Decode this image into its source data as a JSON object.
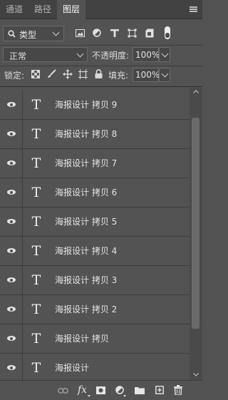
{
  "tabs": [
    {
      "label": "通道",
      "active": false
    },
    {
      "label": "路径",
      "active": false
    },
    {
      "label": "图层",
      "active": true
    }
  ],
  "filter": {
    "selected": "类型",
    "icons": [
      "image-filter-icon",
      "adjustment-filter-icon",
      "type-filter-icon",
      "shape-filter-icon",
      "smart-object-filter-icon",
      "filter-toggle-icon"
    ]
  },
  "blend_mode": {
    "selected": "正常"
  },
  "opacity": {
    "label": "不透明度:",
    "value": "100%"
  },
  "lock": {
    "label": "锁定:",
    "icons": [
      "lock-transparent-pixels-icon",
      "lock-image-pixels-icon",
      "lock-position-icon",
      "lock-artboard-icon",
      "lock-all-icon"
    ]
  },
  "fill": {
    "label": "填充:",
    "value": "100%"
  },
  "layers": [
    {
      "name": "海报设计 拷贝 9",
      "type": "text",
      "visible": true
    },
    {
      "name": "海报设计 拷贝 8",
      "type": "text",
      "visible": true
    },
    {
      "name": "海报设计 拷贝 7",
      "type": "text",
      "visible": true
    },
    {
      "name": "海报设计 拷贝 6",
      "type": "text",
      "visible": true
    },
    {
      "name": "海报设计 拷贝 5",
      "type": "text",
      "visible": true
    },
    {
      "name": "海报设计 拷贝 4",
      "type": "text",
      "visible": true
    },
    {
      "name": "海报设计 拷贝 3",
      "type": "text",
      "visible": true
    },
    {
      "name": "海报设计 拷贝 2",
      "type": "text",
      "visible": true
    },
    {
      "name": "海报设计 拷贝",
      "type": "text",
      "visible": true
    },
    {
      "name": "海报设计",
      "type": "text",
      "visible": true
    }
  ],
  "bottom_toolbar": {
    "fx_label": "fx",
    "icons": [
      "link-layers-icon",
      "layer-style-icon",
      "add-mask-icon",
      "new-adjustment-layer-icon",
      "new-group-icon",
      "new-layer-icon",
      "delete-layer-icon"
    ]
  },
  "colors": {
    "panel_bg": "#535353",
    "tab_bar_bg": "#424242",
    "text": "#e4e4e4"
  }
}
